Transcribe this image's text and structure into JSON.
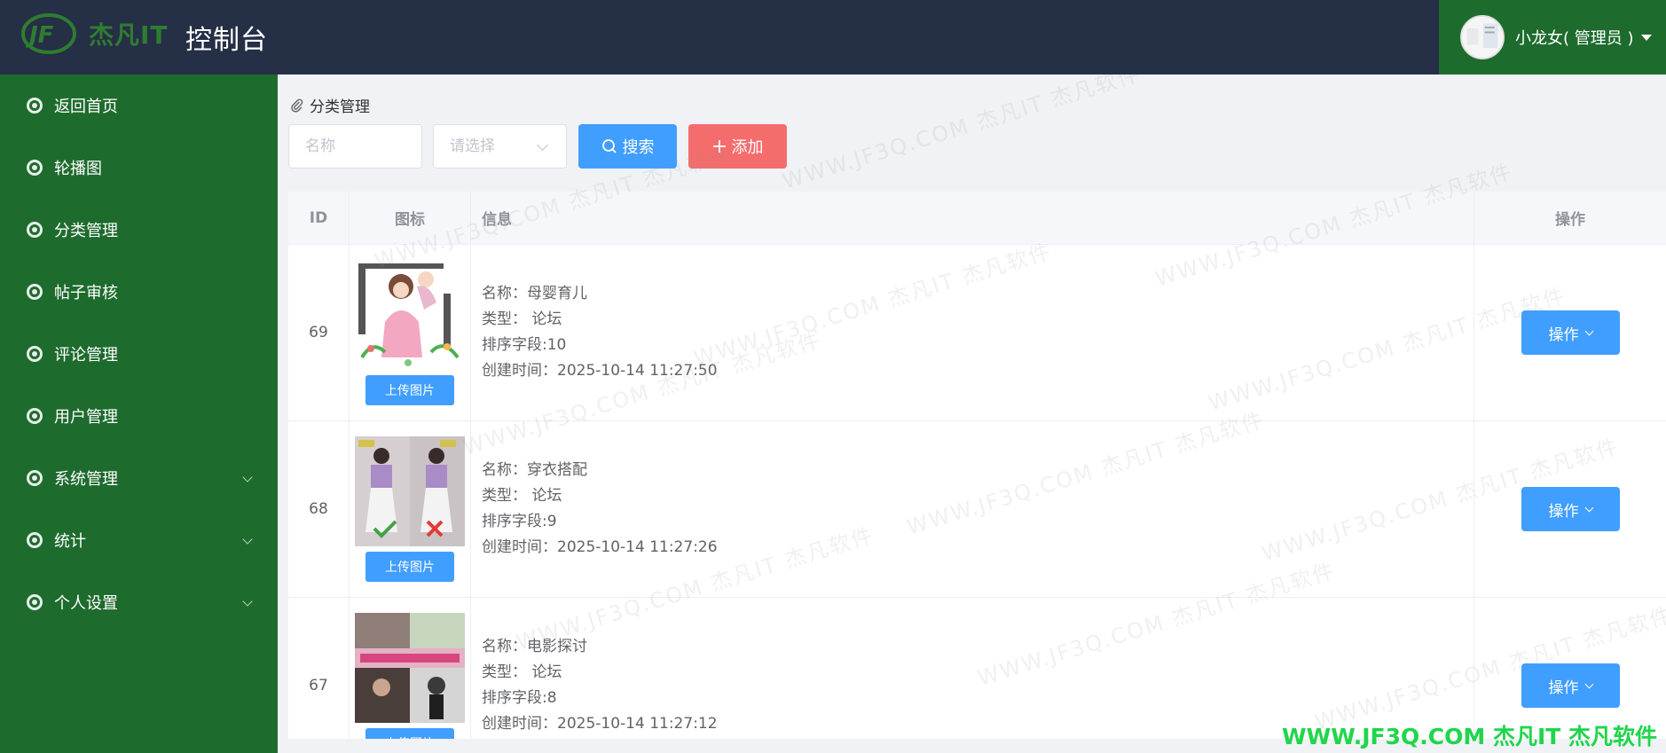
{
  "header": {
    "logo_text": "杰凡IT",
    "title": "控制台",
    "user_name": "小龙女( 管理员 )"
  },
  "sidebar": {
    "items": [
      {
        "label": "返回首页",
        "has_children": false
      },
      {
        "label": "轮播图",
        "has_children": false
      },
      {
        "label": "分类管理",
        "has_children": false
      },
      {
        "label": "帖子审核",
        "has_children": false
      },
      {
        "label": "评论管理",
        "has_children": false
      },
      {
        "label": "用户管理",
        "has_children": false
      },
      {
        "label": "系统管理",
        "has_children": true
      },
      {
        "label": "统计",
        "has_children": true
      },
      {
        "label": "个人设置",
        "has_children": true
      }
    ]
  },
  "main": {
    "breadcrumb": "分类管理",
    "search": {
      "name_placeholder": "名称",
      "select_placeholder": "请选择",
      "search_label": "搜索",
      "add_label": "添加"
    },
    "table": {
      "columns": [
        "ID",
        "图标",
        "信息",
        "操作"
      ],
      "upload_label": "上传图片",
      "op_label": "操作",
      "rows": [
        {
          "id": "69",
          "name": "名称：母婴育儿",
          "type": "类型：  论坛",
          "sort": "排序字段:10",
          "created": "创建时间：2025-10-14 11:27:50"
        },
        {
          "id": "68",
          "name": "名称：穿衣搭配",
          "type": "类型：  论坛",
          "sort": "排序字段:9",
          "created": "创建时间：2025-10-14 11:27:26"
        },
        {
          "id": "67",
          "name": "名称：电影探讨",
          "type": "类型：  论坛",
          "sort": "排序字段:8",
          "created": "创建时间：2025-10-14 11:27:12"
        }
      ]
    }
  },
  "watermark": {
    "text": "WWW.JF3Q.COM 杰凡IT  杰凡软件",
    "footer": "WWW.JF3Q.COM 杰凡IT  杰凡软件"
  },
  "colors": {
    "header_bg": "#252f45",
    "sidebar_bg": "#1e6b2e",
    "primary": "#409eff",
    "danger": "#f56c6c"
  }
}
